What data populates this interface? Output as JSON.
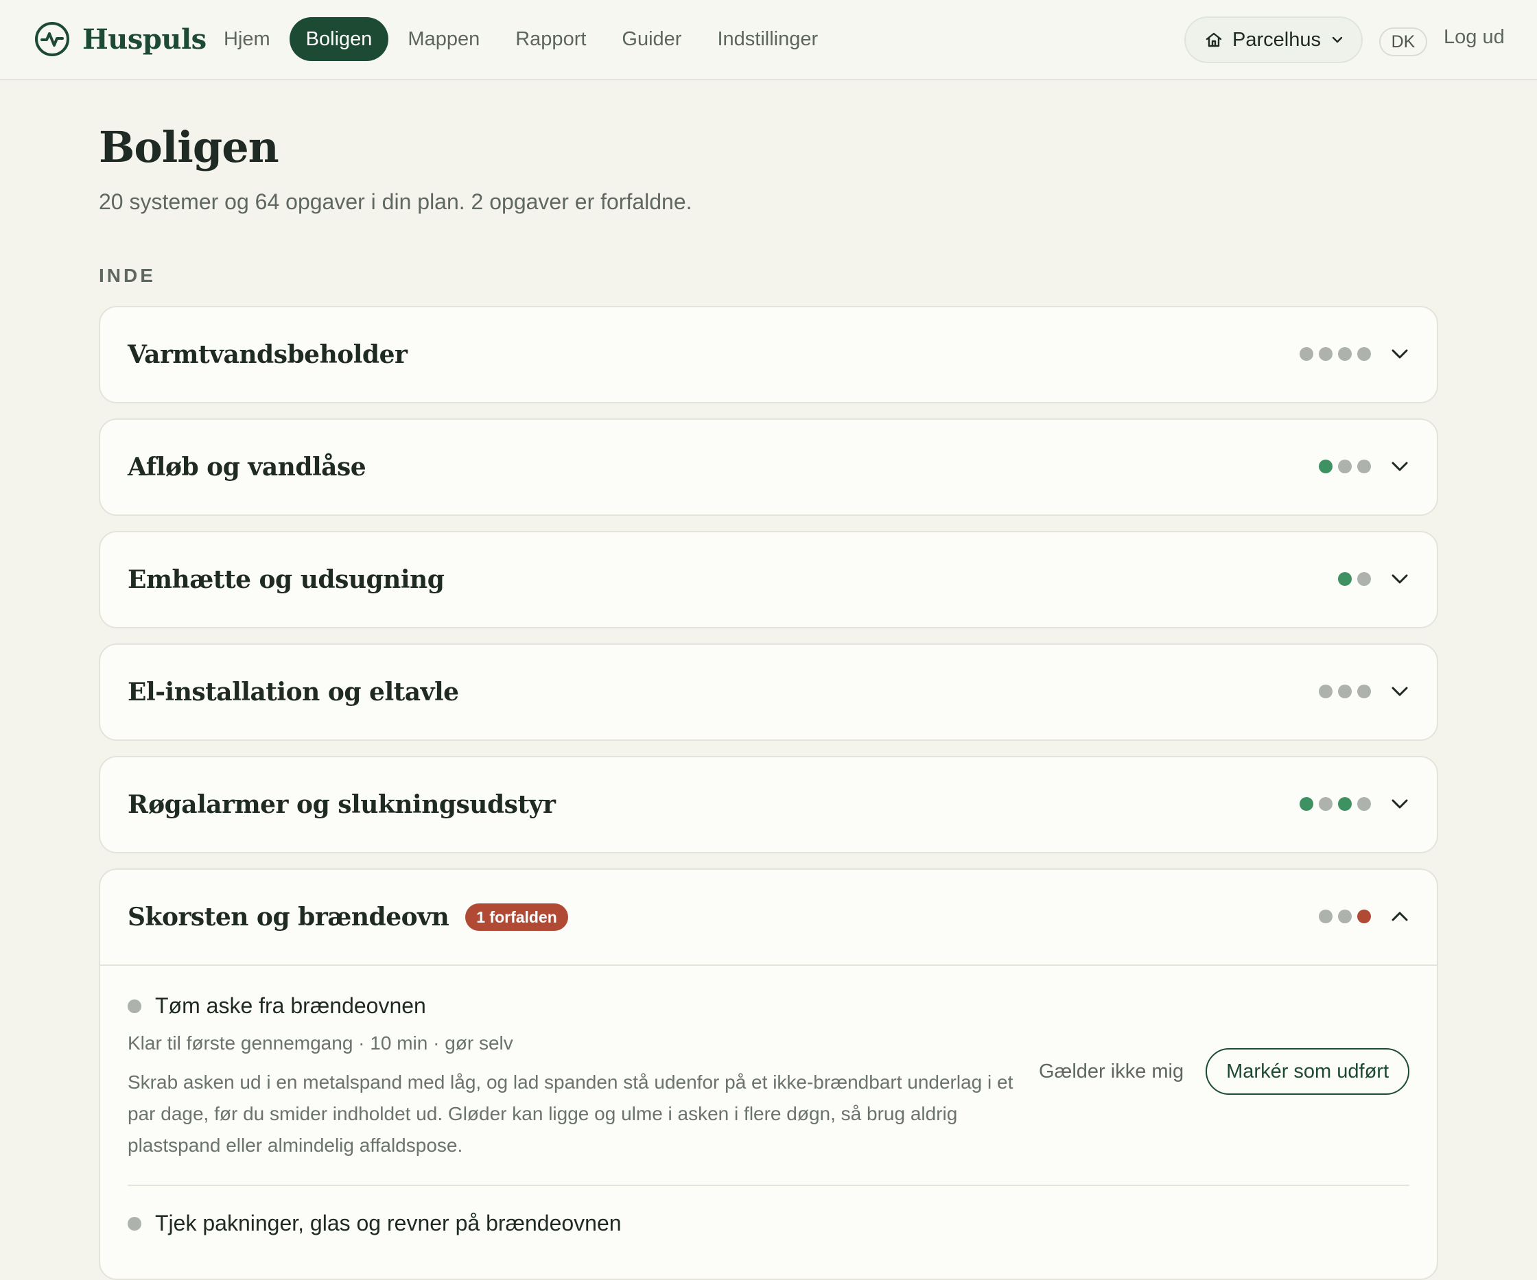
{
  "app": {
    "name": "Huspuls"
  },
  "nav": {
    "items": [
      {
        "label": "Hjem",
        "active": false
      },
      {
        "label": "Boligen",
        "active": true
      },
      {
        "label": "Mappen",
        "active": false
      },
      {
        "label": "Rapport",
        "active": false
      },
      {
        "label": "Guider",
        "active": false
      },
      {
        "label": "Indstillinger",
        "active": false
      }
    ]
  },
  "header_controls": {
    "house_type": "Parcelhus",
    "language": "DK",
    "logout": "Log ud"
  },
  "page": {
    "title": "Boligen",
    "subtitle": "20 systemer og 64 opgaver i din plan. 2 opgaver er forfaldne.",
    "section": "INDE"
  },
  "systems": [
    {
      "title": "Varmtvandsbeholder",
      "dots": [
        "grey",
        "grey",
        "grey",
        "grey"
      ],
      "expanded": false
    },
    {
      "title": "Afløb og vandlåse",
      "dots": [
        "green",
        "grey",
        "grey"
      ],
      "expanded": false
    },
    {
      "title": "Emhætte og udsugning",
      "dots": [
        "green",
        "grey"
      ],
      "expanded": false
    },
    {
      "title": "El-installation og eltavle",
      "dots": [
        "grey",
        "grey",
        "grey"
      ],
      "expanded": false
    },
    {
      "title": "Røgalarmer og slukningsudstyr",
      "dots": [
        "green",
        "grey",
        "green",
        "grey"
      ],
      "expanded": false
    },
    {
      "title": "Skorsten og brændeovn",
      "badge": "1 forfalden",
      "dots": [
        "grey",
        "grey",
        "red"
      ],
      "expanded": true,
      "tasks": [
        {
          "title": "Tøm aske fra brændeovnen",
          "meta": "Klar til første gennemgang · 10 min · gør selv",
          "description": "Skrab asken ud i en metalspand med låg, og lad spanden stå udenfor på et ikke-brændbart underlag i et par dage, før du smider indholdet ud. Gløder kan ligge og ulme i asken i flere døgn, så brug aldrig plastspand eller almindelig affaldspose.",
          "not_applicable": "Gælder ikke mig",
          "mark_done": "Markér som udført"
        },
        {
          "title": "Tjek pakninger, glas og revner på brændeovnen"
        }
      ]
    }
  ],
  "colors": {
    "brand": "#1d4a33",
    "status_ok": "#3e9160",
    "status_overdue": "#b04a35",
    "status_pending": "#aeb2ac"
  }
}
